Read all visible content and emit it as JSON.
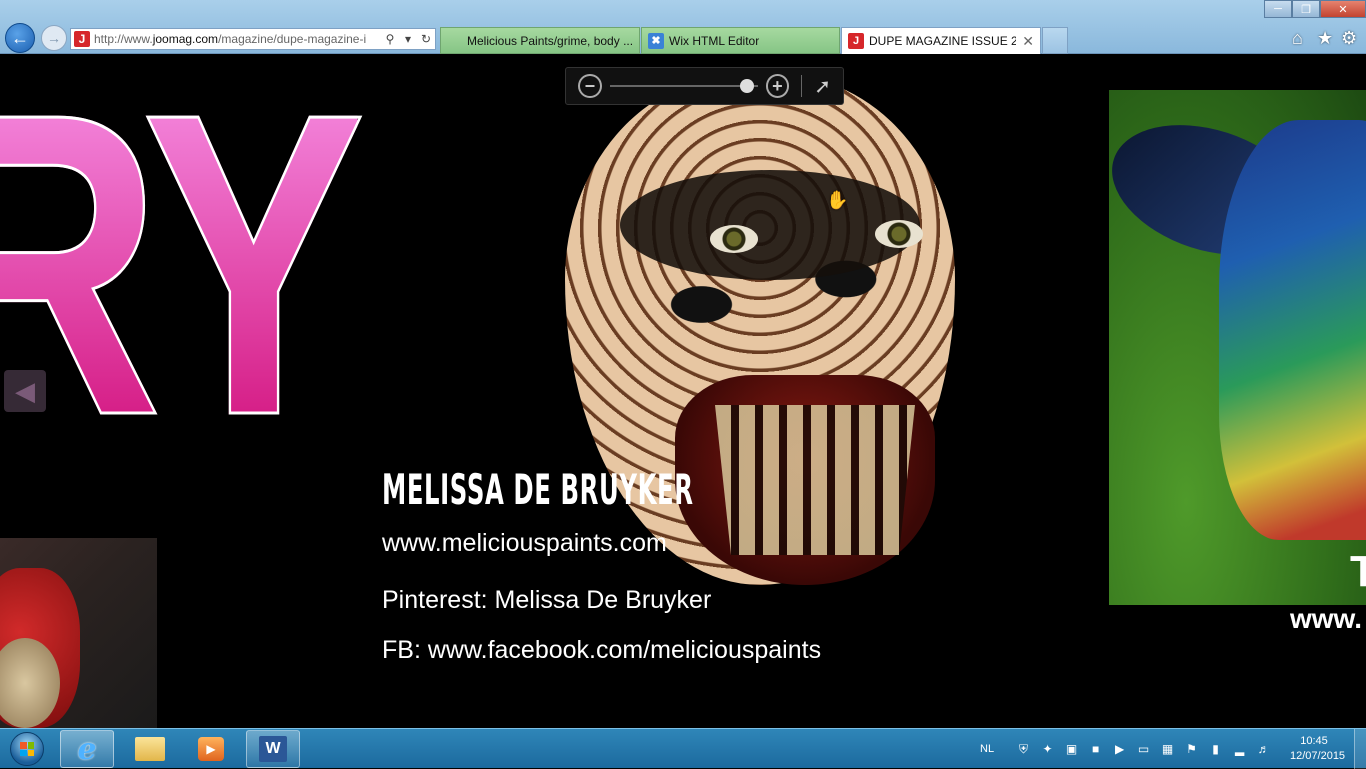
{
  "browser": {
    "url_prefix": "http://www.",
    "url_domain": "joomag.com",
    "url_path": "/magazine/dupe-magazine-i",
    "tabs": [
      {
        "label": "Melicious Paints/grime, body ..."
      },
      {
        "label": "Wix HTML Editor"
      },
      {
        "label": "DUPE MAGAZINE ISSUE 2 J..."
      }
    ],
    "tab_close": "✕"
  },
  "magazine": {
    "left_page_letters": "RY",
    "artist_name": "MELISSA DE BRUYKER",
    "website": "www.meliciouspaints.com",
    "pinterest": "Pinterest: Melissa De Bruyker",
    "facebook": "FB: www.facebook.com/meliciouspaints",
    "right_caption_1": "T",
    "right_caption_2": "www."
  },
  "zoom": {
    "level": 0.93,
    "zoom_out_label": "−",
    "zoom_in_label": "+"
  },
  "taskbar": {
    "language": "NL",
    "time": "10:45",
    "date": "12/07/2015",
    "word_label": "W"
  },
  "colors": {
    "magenta_letters": "#e0309a",
    "page_background": "#000000",
    "taskbar": "#1c6a9e"
  }
}
